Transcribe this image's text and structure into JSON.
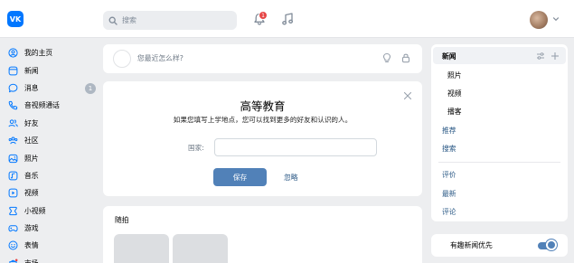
{
  "header": {
    "logo_text": "VK",
    "search_placeholder": "搜索",
    "notifications_count": "1",
    "icons": [
      "vk-logo-icon",
      "search-icon",
      "bell-icon",
      "music-icon",
      "avatar",
      "chevron-down-icon"
    ]
  },
  "nav": {
    "items": [
      {
        "label": "我的主页",
        "icon": "user-circle-icon"
      },
      {
        "label": "新闻",
        "icon": "newsfeed-icon"
      },
      {
        "label": "消息",
        "icon": "message-icon",
        "count": "1"
      },
      {
        "label": "音视频通话",
        "icon": "phone-icon"
      },
      {
        "label": "好友",
        "icon": "friends-icon"
      },
      {
        "label": "社区",
        "icon": "community-icon"
      },
      {
        "label": "照片",
        "icon": "photo-icon"
      },
      {
        "label": "音乐",
        "icon": "music-icon"
      },
      {
        "label": "视频",
        "icon": "video-icon"
      },
      {
        "label": "小视频",
        "icon": "clips-icon"
      },
      {
        "label": "游戏",
        "icon": "gamepad-icon"
      },
      {
        "label": "表情",
        "icon": "smile-icon"
      },
      {
        "label": "市场",
        "icon": "market-icon"
      }
    ]
  },
  "post_box": {
    "placeholder": "您最近怎么样?"
  },
  "education": {
    "title": "高等教育",
    "subtitle": "如果您填写上学地点，您可以找到更多的好友和认识的人。",
    "country_label": "国家:",
    "country_value": "",
    "save_label": "保存",
    "ignore_label": "忽略"
  },
  "snaps": {
    "title": "随拍"
  },
  "right_menu": {
    "items": [
      {
        "label": "新闻",
        "active": true
      },
      {
        "label": "照片"
      },
      {
        "label": "视频"
      },
      {
        "label": "播客"
      },
      {
        "label": "推荐"
      },
      {
        "label": "搜索"
      },
      {
        "label": "评价"
      },
      {
        "label": "最新"
      },
      {
        "label": "评论"
      }
    ]
  },
  "preferences": {
    "interesting_first_label": "有趣新闻优先",
    "interesting_first_on": true
  },
  "colors": {
    "brand": "#0077ff",
    "button": "#5181b8",
    "link": "#2a5885",
    "badge_red": "#e64646",
    "page_bg": "#edeef0"
  }
}
